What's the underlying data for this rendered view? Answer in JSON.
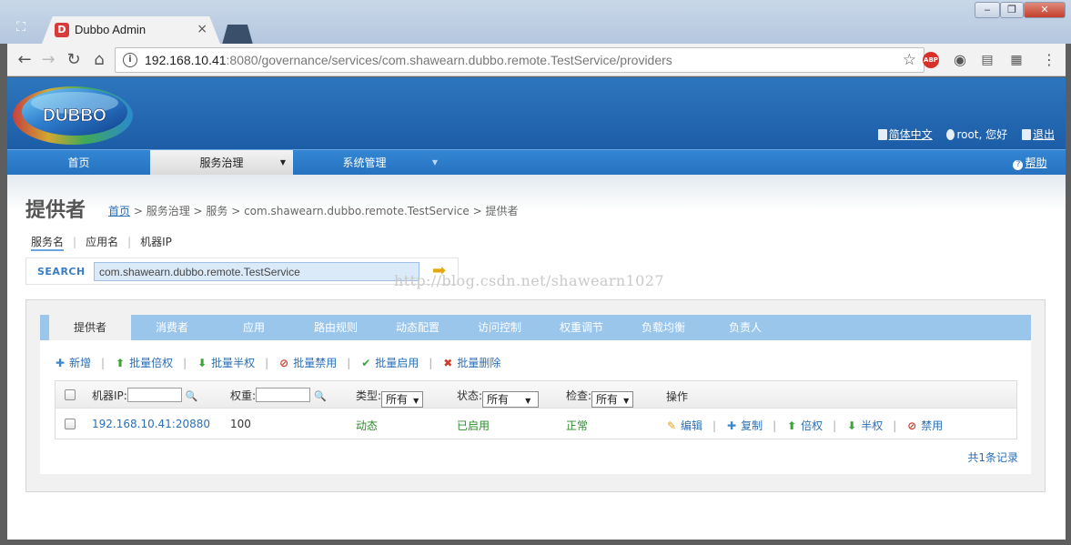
{
  "browser": {
    "tab_title": "Dubbo Admin",
    "tab_close": "×",
    "url_host": "192.168.10.41",
    "url_rest": ":8080/governance/services/com.shawearn.dubbo.remote.TestService/providers",
    "abp_label": "ABP",
    "icons": [
      "back-icon",
      "forward-icon",
      "reload-icon",
      "home-icon",
      "info-icon",
      "star-icon",
      "menu-icon"
    ]
  },
  "header": {
    "logo_text": "DUBBO",
    "language": "简体中文",
    "greeting": "root, 您好",
    "logout": "退出"
  },
  "menu": {
    "home": "首页",
    "governance": "服务治理",
    "system": "系统管理",
    "help": "帮助"
  },
  "page": {
    "title": "提供者",
    "breadcrumb_home": "首页",
    "breadcrumb_rest": " > 服务治理 > 服务 > com.shawearn.dubbo.remote.TestService > 提供者"
  },
  "search": {
    "tabs": [
      "服务名",
      "应用名",
      "机器IP"
    ],
    "label": "SEARCH",
    "value": "com.shawearn.dubbo.remote.TestService"
  },
  "watermark": "http://blog.csdn.net/shawearn1027",
  "tabs": [
    "提供者",
    "消费者",
    "应用",
    "路由规则",
    "动态配置",
    "访问控制",
    "权重调节",
    "负载均衡",
    "负责人"
  ],
  "actions": [
    {
      "icon": "plus-icon",
      "glyph": "✚",
      "label": "新增",
      "color": "#3a86d0"
    },
    {
      "icon": "arrow-up-icon",
      "glyph": "⬆",
      "label": "批量倍权",
      "color": "#3aa63a"
    },
    {
      "icon": "arrow-down-icon",
      "glyph": "⬇",
      "label": "批量半权",
      "color": "#3aa63a"
    },
    {
      "icon": "ban-icon",
      "glyph": "⊘",
      "label": "批量禁用",
      "color": "#d23b2a"
    },
    {
      "icon": "check-icon",
      "glyph": "✔",
      "label": "批量启用",
      "color": "#3aa63a"
    },
    {
      "icon": "cross-icon",
      "glyph": "✖",
      "label": "批量删除",
      "color": "#d23b2a"
    }
  ],
  "grid": {
    "headers": {
      "ip": "机器IP:",
      "weight": "权重:",
      "type": "类型:",
      "status": "状态:",
      "check": "检查:",
      "ops": "操作"
    },
    "type_value": "所有",
    "status_value": "所有",
    "check_value": "所有",
    "rows": [
      {
        "address": "192.168.10.41:20880",
        "weight": "100",
        "type": "动态",
        "status": "已启用",
        "check": "正常",
        "ops": [
          "编辑",
          "复制",
          "倍权",
          "半权",
          "禁用"
        ]
      }
    ]
  },
  "records": "共1条记录"
}
